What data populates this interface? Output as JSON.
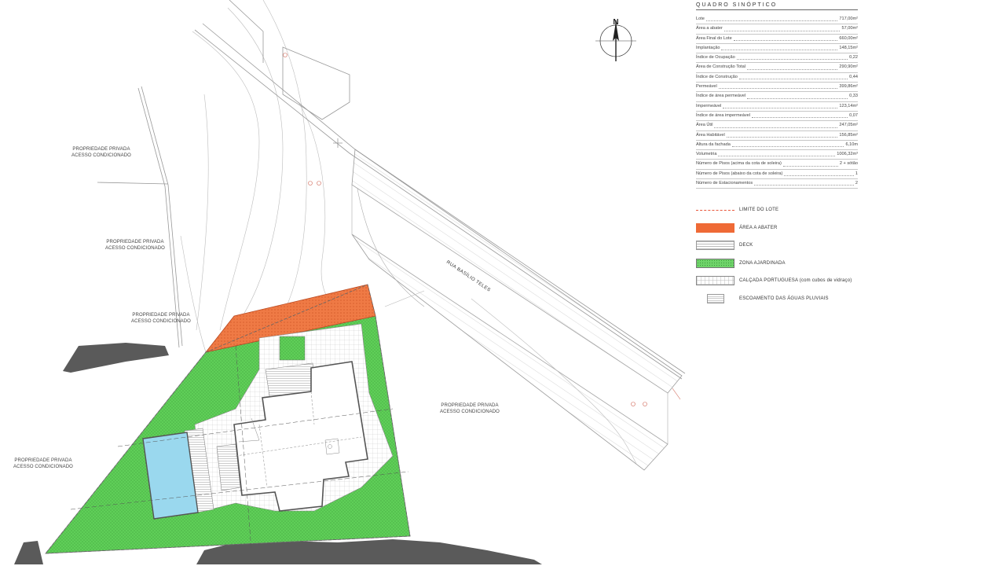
{
  "quadro": {
    "title": "QUADRO SINÓPTICO",
    "rows": [
      {
        "label": "Lote",
        "value": "717,00m²"
      },
      {
        "label": "Área a abater",
        "value": "57,00m²"
      },
      {
        "label": "Área Final do Lote",
        "value": "660,00m²"
      },
      {
        "label": "Implantação",
        "value": "148,15m²"
      },
      {
        "label": "Índice de Ocupação",
        "value": "0,22"
      },
      {
        "label": "Área de Construção Total",
        "value": "290,90m²"
      },
      {
        "label": "Índice de Construção",
        "value": "0,44"
      },
      {
        "label": "Permeável",
        "value": "399,86m²"
      },
      {
        "label": "Índice de área permeável",
        "value": "0,33"
      },
      {
        "label": "Impermeável",
        "value": "123,14m²"
      },
      {
        "label": "Índice de área impermeável",
        "value": "0,07"
      },
      {
        "label": "Área Útil",
        "value": "247,05m²"
      },
      {
        "label": "Área Habitável",
        "value": "156,85m²"
      },
      {
        "label": "Altura da fachada",
        "value": "6,10m"
      },
      {
        "label": "Volumetria",
        "value": "1006,32m³"
      },
      {
        "label": "Número de Pisos (acima da cota de soleira)",
        "value": "2 + sótão"
      },
      {
        "label": "Número de Pisos (abaixo da cota de soleira)",
        "value": "1"
      },
      {
        "label": "Número de Estacionamentos",
        "value": "2"
      }
    ]
  },
  "legend": [
    {
      "key": "limit",
      "label": "LIMITE DO LOTE",
      "color": "#e8563a"
    },
    {
      "key": "orange",
      "label": "ÁREA A ABATER",
      "color": "#ef6a36"
    },
    {
      "key": "deck",
      "label": "DECK",
      "color": "#bbbbbb"
    },
    {
      "key": "green",
      "label": "ZONA AJARDINADA",
      "color": "#6fd36a"
    },
    {
      "key": "calcada",
      "label": "CALÇADA PORTUGUESA (com cubos de vidraço)",
      "color": "#ffffff"
    },
    {
      "key": "pluv",
      "label": "ESCOAMENTO DAS ÁGUAS PLUVIAIS",
      "color": "#999999"
    }
  ],
  "north": "N",
  "street": "RUA BASÍLIO TELES",
  "neighbours": [
    {
      "l1": "PROPRIEDADE PRIVADA",
      "l2": "ACESSO CONDICIONADO"
    },
    {
      "l1": "PROPRIEDADE PRIVADA",
      "l2": "ACESSO CONDICIONADO"
    },
    {
      "l1": "PROPRIEDADE PRIVADA",
      "l2": "ACESSO CONDICIONADO"
    },
    {
      "l1": "PROPRIEDADE PRIVADA",
      "l2": "ACESSO CONDICIONADO"
    },
    {
      "l1": "PROPRIEDADE PRIVADA",
      "l2": "ACESSO CONDICIONADO"
    }
  ],
  "colors": {
    "garden": "#5fcf58",
    "abate": "#ef6a36",
    "pool": "#9ad8ee",
    "shadow": "#555555",
    "line": "#9a9a9a"
  }
}
